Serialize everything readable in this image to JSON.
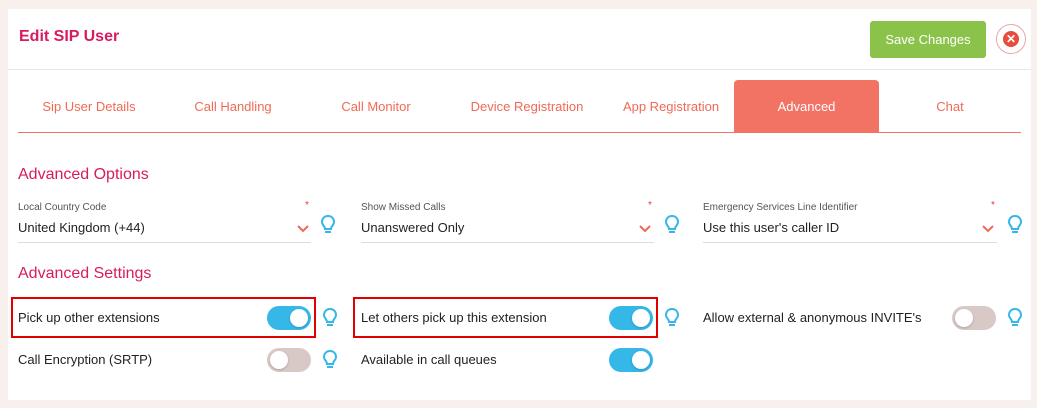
{
  "header": {
    "title": "Edit SIP User",
    "save_label": "Save Changes",
    "close_icon": "close-icon"
  },
  "tabs": [
    {
      "label": "Sip User Details",
      "active": false
    },
    {
      "label": "Call Handling",
      "active": false
    },
    {
      "label": "Call Monitor",
      "active": false
    },
    {
      "label": "Device Registration",
      "active": false
    },
    {
      "label": "App Registration",
      "active": false
    },
    {
      "label": "Advanced",
      "active": true
    },
    {
      "label": "Chat",
      "active": false
    }
  ],
  "advanced_options": {
    "title": "Advanced Options",
    "fields": [
      {
        "label": "Local Country Code",
        "required": "*",
        "value": "United Kingdom (+44)"
      },
      {
        "label": "Show Missed Calls",
        "required": "*",
        "value": "Unanswered Only"
      },
      {
        "label": "Emergency Services Line Identifier",
        "required": "*",
        "value": "Use this user's caller ID"
      }
    ]
  },
  "advanced_settings": {
    "title": "Advanced Settings",
    "items": [
      {
        "label": "Pick up other extensions",
        "enabled": true,
        "highlighted": true
      },
      {
        "label": "Let others pick up this extension",
        "enabled": true,
        "highlighted": true
      },
      {
        "label": "Allow external & anonymous INVITE's",
        "enabled": false,
        "highlighted": false
      },
      {
        "label": "Call Encryption (SRTP)",
        "enabled": false,
        "highlighted": false
      },
      {
        "label": "Available in call queues",
        "enabled": true,
        "highlighted": false
      }
    ]
  },
  "colors": {
    "accent": "#d81b60",
    "tab_active": "#f27263",
    "save": "#8bc34a",
    "toggle_on": "#35b7e8",
    "toggle_off": "#d8c9c6",
    "highlight": "#e00000"
  }
}
